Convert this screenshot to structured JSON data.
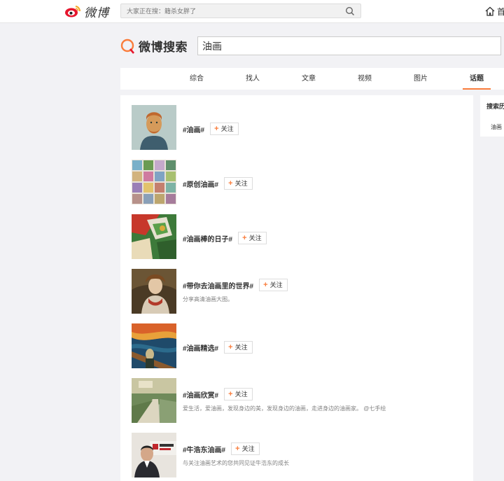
{
  "topbar": {
    "logo_text": "微博",
    "search_placeholder": "大家正在搜：籍杀女胖了",
    "home_label": "首"
  },
  "search": {
    "brand_text": "微博搜索",
    "query": "油画"
  },
  "tabs": [
    {
      "label": "综合"
    },
    {
      "label": "找人"
    },
    {
      "label": "文章"
    },
    {
      "label": "视频"
    },
    {
      "label": "图片"
    },
    {
      "label": "话题"
    }
  ],
  "active_tab": "话题",
  "follow_label": "关注",
  "results": [
    {
      "topic": "#油画#",
      "desc": ""
    },
    {
      "topic": "#原创油画#",
      "desc": ""
    },
    {
      "topic": "#油画棒的日子#",
      "desc": ""
    },
    {
      "topic": "#带你去油画里的世界#",
      "desc": "分享高清油画大图。"
    },
    {
      "topic": "#油画精选#",
      "desc": ""
    },
    {
      "topic": "#油画欣赏#",
      "desc": "爱生活，爱油画，发现身边的美，发现身边的油画，走进身边的油画家。 @七手绘"
    },
    {
      "topic": "#牛浩东油画#",
      "desc": "与关注油画艺术的您共同见证牛浩东的成长"
    }
  ],
  "side": {
    "title": "搜索历",
    "item": "油画"
  },
  "colors": {
    "accent": "#fa7d3c",
    "page_bg": "#f2f2f5"
  }
}
